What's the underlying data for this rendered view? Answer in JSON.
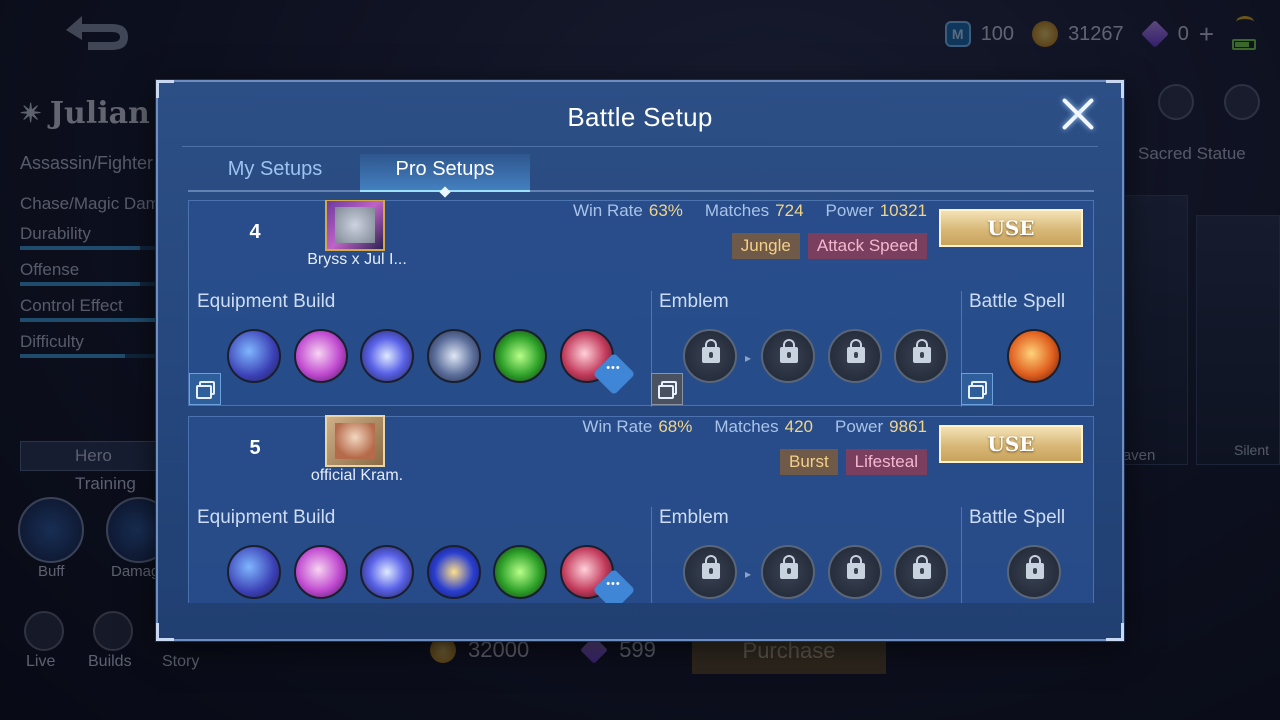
{
  "topbar": {
    "ticket": "100",
    "gold": "31267",
    "diamonds": "0",
    "plus": "+"
  },
  "hero": {
    "name": "Julian",
    "role": "Assassin/Fighter",
    "type": "Chase/Magic Damage",
    "stats": [
      {
        "label": "Durability",
        "value": 0.8
      },
      {
        "label": "Offense",
        "value": 0.8
      },
      {
        "label": "Control Effect",
        "value": 0.9
      },
      {
        "label": "Difficulty",
        "value": 0.7
      }
    ],
    "hero_training": "Hero Training",
    "tabs": [
      {
        "label": "Buff"
      },
      {
        "label": "Damage"
      }
    ],
    "bottom_nav": [
      {
        "label": "Live"
      },
      {
        "label": "Builds"
      },
      {
        "label": "Story"
      }
    ]
  },
  "shop": {
    "gold_price": "32000",
    "diamond_price": "599",
    "purchase": "Purchase"
  },
  "skins": {
    "sacred_statue": "Sacred Statue",
    "raven": "Raven",
    "silent": "Silent"
  },
  "modal": {
    "title": "Battle Setup",
    "tabs": [
      {
        "label": "My Setups"
      },
      {
        "label": "Pro Setups"
      }
    ],
    "active_tab": "Pro Setups",
    "labels": {
      "win_rate": "Win Rate",
      "matches": "Matches",
      "power": "Power",
      "equipment_build": "Equipment Build",
      "emblem": "Emblem",
      "battle_spell": "Battle Spell",
      "use": "USE"
    },
    "setups": [
      {
        "rank": "4",
        "player": "Bryss x Jul I...",
        "win_rate": "63%",
        "matches": "724",
        "power": "10321",
        "tags": [
          "Jungle",
          "Attack Speed"
        ],
        "equipment": [
          "boots-icon",
          "feather-icon",
          "orb-icon",
          "trident-icon",
          "crystal-icon",
          "blade-icon"
        ],
        "emblems": [
          "locked-talent-icon",
          "locked-talent-icon",
          "locked-talent-icon",
          "locked-talent-icon"
        ],
        "spell": "retribution-icon"
      },
      {
        "rank": "5",
        "player": "official Kram.",
        "win_rate": "68%",
        "matches": "420",
        "power": "9861",
        "tags": [
          "Burst",
          "Lifesteal"
        ],
        "equipment": [
          "boots-icon",
          "feather-icon",
          "orb-icon",
          "wand-icon",
          "crystal-icon",
          "blade-icon"
        ],
        "emblems": [
          "locked-talent-icon",
          "locked-talent-icon",
          "locked-talent-icon",
          "locked-talent-icon"
        ],
        "spell": "locked-spell-icon"
      }
    ]
  },
  "colors": {
    "modal_bg": "#2c4f86",
    "accent_gold": "#f1d489",
    "tag_role": "#6f5a4a",
    "tag_style": "#7a3f5e",
    "use_button": "#d8b877"
  }
}
